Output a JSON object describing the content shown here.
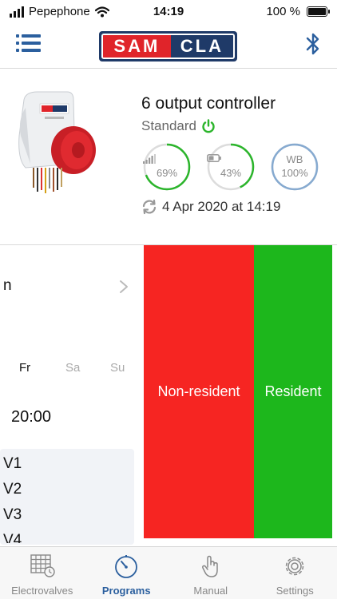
{
  "status": {
    "carrier": "Pepephone",
    "time": "14:19",
    "battery": "100 %"
  },
  "header": {
    "logo_left": "SAM",
    "logo_right": "CLA"
  },
  "device": {
    "title": "6 output controller",
    "mode": "Standard",
    "gauges": [
      {
        "label": "69%",
        "level": 0.69,
        "color": "#2bb52b"
      },
      {
        "label": "43%",
        "level": 0.43,
        "color": "#2bb52b"
      },
      {
        "top": "WB",
        "label": "100%",
        "level": 1.0,
        "color": "#86aad0"
      }
    ],
    "last_sync": "4 Apr 2020 at 14:19"
  },
  "program": {
    "row_label": "n",
    "days": [
      "Fr",
      "Sa",
      "Su"
    ],
    "start_time": "20:00",
    "valves": [
      "V1",
      "V2",
      "V3",
      "V4"
    ]
  },
  "actions": {
    "non_resident": "Non-resident",
    "resident": "Resident"
  },
  "tabs": [
    {
      "label": "Electrovalves"
    },
    {
      "label": "Programs"
    },
    {
      "label": "Manual"
    },
    {
      "label": "Settings"
    }
  ],
  "colors": {
    "accent": "#2b5f9e",
    "red_action": "#f62522",
    "green_action": "#1db71c"
  }
}
